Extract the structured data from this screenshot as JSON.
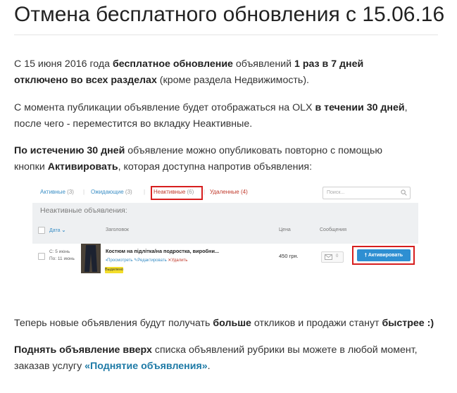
{
  "article": {
    "title": "Отмена бесплатного обновления с 15.06.16",
    "p1": {
      "t1": "С 15 июня 2016 года ",
      "b1": "бесплатное обновление",
      "t2": " объявлений ",
      "b2": "1 раз в 7 дней",
      "b3": "отключено во всех разделах",
      "t3": " (кроме раздела Недвижимость)."
    },
    "p2": {
      "t1": "С момента публикации объявление будет отображаться на OLX ",
      "b1": "в течении 30 дней",
      "t2": ",",
      "t3": "после чего - переместится во вкладку Неактивные."
    },
    "p3": {
      "b1": "По истечению 30 дней",
      "t1": " объявление можно опубликовать повторно с помощью",
      "t2": "кнопки ",
      "b2": "Активировать",
      "t3": ", которая доступна напротив объявления:"
    },
    "p4": {
      "t1": "Теперь новые объявления будут получать ",
      "b1": "больше",
      "t2": " откликов и продажи станут ",
      "b2": "быстрее :)"
    },
    "p5": {
      "b1": "Поднять объявление вверх",
      "t1": " списка объявлений рубрики вы можете в любой момент,",
      "t2": "заказав услугу ",
      "link": "«Поднятие объявления»",
      "t3": "."
    }
  },
  "screenshot": {
    "tabs": [
      {
        "label": "Активные",
        "count": "(3)"
      },
      {
        "label": "Ожидающие",
        "count": "(3)"
      },
      {
        "label": "Неактивные",
        "count": "(6)"
      },
      {
        "label": "Удаленные",
        "count": "(4)"
      }
    ],
    "search_placeholder": "Поиск...",
    "section_title": "Неактивные объявления:",
    "headers": {
      "date": "Дата",
      "title": "Заголовок",
      "price": "Цена",
      "messages": "Сообщения"
    },
    "row": {
      "date_from": "С: 5 июнь",
      "date_to": "По: 11 июнь",
      "title": "Костюм на підліткa/на подростка, виробни...",
      "actions": {
        "view": "Просмотреть",
        "edit": "Редактировать",
        "delete": "Удалить"
      },
      "status": "Выделено",
      "price": "450 грн.",
      "messages": "0",
      "activate": "Активировать"
    }
  },
  "colors": {
    "link": "#1e7aa6",
    "highlight": "#d71e1e",
    "button": "#2e8fd2"
  }
}
